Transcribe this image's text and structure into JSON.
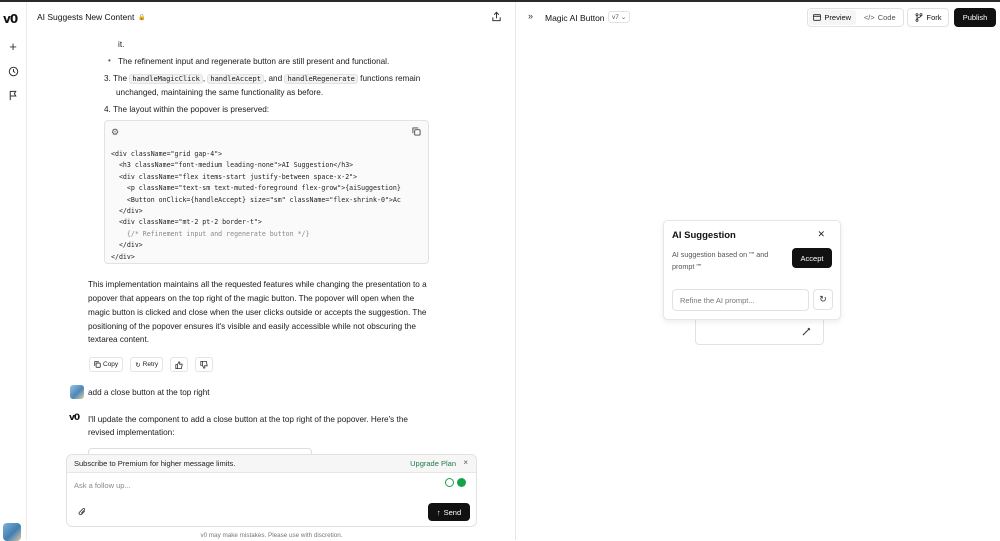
{
  "rail": {
    "logo": "v0",
    "icons": [
      "plus-icon",
      "history-icon",
      "flag-icon"
    ]
  },
  "chat": {
    "title": "AI Suggests New Content",
    "lines": {
      "l1": "it.",
      "l2": "The refinement input and regenerate button are still present and functional.",
      "l3_num": "3.",
      "l3_pre": "The",
      "l3_c1": "handleMagicClick",
      "l3_mid1": ",",
      "l3_c2": "handleAccept",
      "l3_mid2": ", and",
      "l3_c3": "handleRegenerate",
      "l3_post": "functions remain",
      "l3b": "unchanged, maintaining the same functionality as before.",
      "l4_num": "4.",
      "l4": "The layout within the popover is preserved:"
    },
    "code_lines": [
      "<div className=\"grid gap-4\">",
      "  <h3 className=\"font-medium leading-none\">AI Suggestion</h3>",
      "  <div className=\"flex items-start justify-between space-x-2\">",
      "    <p className=\"text-sm text-muted-foreground flex-grow\">{aiSuggestion}",
      "    <Button onClick={handleAccept} size=\"sm\" className=\"flex-shrink-0\">Ac",
      "  </div>",
      "  <div className=\"mt-2 pt-2 border-t\">",
      "    {/* Refinement input and regenerate button */}",
      "  </div>",
      "</div>"
    ],
    "para": [
      "This implementation maintains all the requested features while changing the presentation to a",
      "popover that appears on the top right of the magic button. The popover will open when the",
      "magic button is clicked and close when the user clicks outside or accepts the suggestion. The",
      "positioning of the popover ensures it's visible and easily accessible while not obscuring the",
      "textarea content."
    ],
    "actions": {
      "copy": "Copy",
      "retry": "Retry"
    },
    "user_msg": "add a close button at the top right",
    "reply": [
      "I'll update the component to add a close button at the top right of the popover. Here's the",
      "revised implementation:"
    ],
    "composer": {
      "promo": "Subscribe to Premium for higher message limits.",
      "upgrade": "Upgrade Plan",
      "placeholder": "Ask a follow up...",
      "send": "Send"
    },
    "disclaimer": "v0 may make mistakes. Please use with discretion."
  },
  "preview": {
    "title": "Magic AI Button",
    "version": "v7",
    "tabs": {
      "preview": "Preview",
      "code": "Code"
    },
    "fork": "Fork",
    "publish": "Publish",
    "popover": {
      "title": "AI Suggestion",
      "desc": "AI suggestion based on \"\" and prompt \"\"",
      "accept": "Accept",
      "refine_placeholder": "Refine the AI prompt..."
    }
  }
}
